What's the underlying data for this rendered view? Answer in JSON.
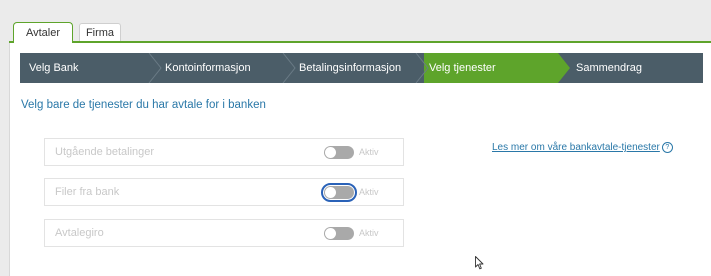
{
  "tabs": [
    {
      "label": "Avtaler",
      "active": true
    },
    {
      "label": "Firma",
      "active": false
    }
  ],
  "steps": [
    {
      "label": "Velg Bank",
      "active": false
    },
    {
      "label": "Kontoinformasjon",
      "active": false
    },
    {
      "label": "Betalingsinformasjon",
      "active": false
    },
    {
      "label": "Velg tjenester",
      "active": true
    },
    {
      "label": "Sammendrag",
      "active": false
    }
  ],
  "main": {
    "hint": "Velg bare de tjenester du har avtale for i banken",
    "read_more": "Les mer om våre bankavtale-tjenester",
    "services": [
      {
        "label": "Utgående betalinger",
        "status": "Aktiv",
        "on": false
      },
      {
        "label": "Filer fra bank",
        "status": "Aktiv",
        "on": false
      },
      {
        "label": "Avtalegiro",
        "status": "Aktiv",
        "on": false
      }
    ]
  },
  "colors": {
    "accent": "#5ea42b",
    "step_bar": "#4b5d68",
    "link": "#2a78a8",
    "toggle_off": "#a9a9a9"
  },
  "icons": {
    "info": "info-icon",
    "cursor": "mouse-pointer-icon"
  }
}
